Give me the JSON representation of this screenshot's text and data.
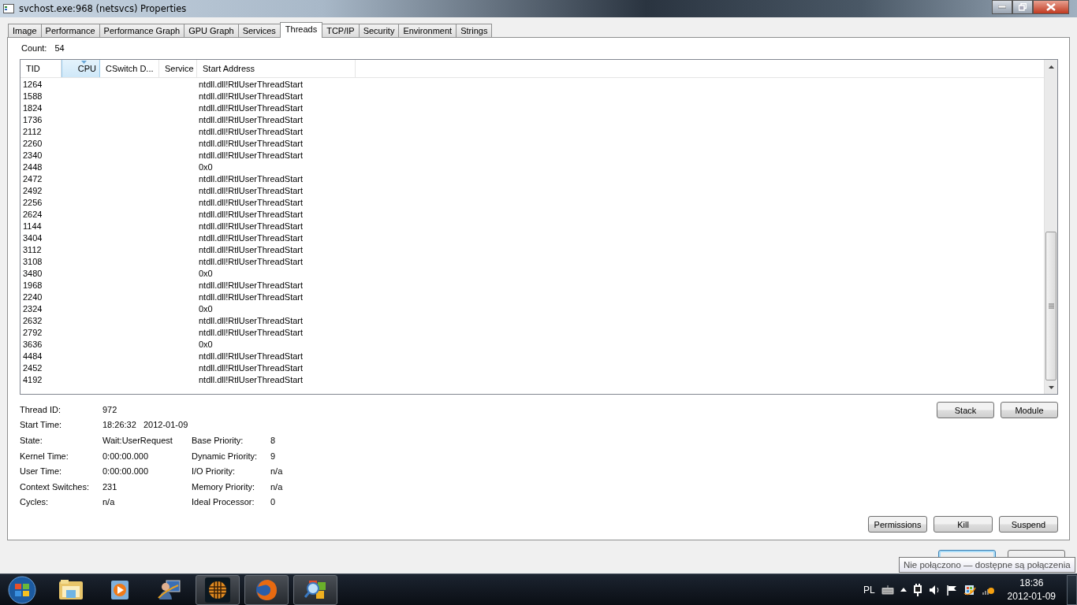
{
  "window": {
    "title": "svchost.exe:968 (netsvcs) Properties"
  },
  "tabs": [
    {
      "label": "Image",
      "selected": false
    },
    {
      "label": "Performance",
      "selected": false
    },
    {
      "label": "Performance Graph",
      "selected": false
    },
    {
      "label": "GPU Graph",
      "selected": false
    },
    {
      "label": "Services",
      "selected": false
    },
    {
      "label": "Threads",
      "selected": true
    },
    {
      "label": "TCP/IP",
      "selected": false
    },
    {
      "label": "Security",
      "selected": false
    },
    {
      "label": "Environment",
      "selected": false
    },
    {
      "label": "Strings",
      "selected": false
    }
  ],
  "count": {
    "label": "Count:",
    "value": "54"
  },
  "threads": {
    "columns": [
      {
        "label": "TID",
        "sorted": false
      },
      {
        "label": "CPU",
        "sorted": true
      },
      {
        "label": "CSwitch D...",
        "sorted": false
      },
      {
        "label": "Service",
        "sorted": false
      },
      {
        "label": "Start Address",
        "sorted": false
      }
    ],
    "rows": [
      {
        "tid": "1264",
        "start_address": "ntdll.dll!RtlUserThreadStart"
      },
      {
        "tid": "1588",
        "start_address": "ntdll.dll!RtlUserThreadStart"
      },
      {
        "tid": "1824",
        "start_address": "ntdll.dll!RtlUserThreadStart"
      },
      {
        "tid": "1736",
        "start_address": "ntdll.dll!RtlUserThreadStart"
      },
      {
        "tid": "2112",
        "start_address": "ntdll.dll!RtlUserThreadStart"
      },
      {
        "tid": "2260",
        "start_address": "ntdll.dll!RtlUserThreadStart"
      },
      {
        "tid": "2340",
        "start_address": "ntdll.dll!RtlUserThreadStart"
      },
      {
        "tid": "2448",
        "start_address": "0x0"
      },
      {
        "tid": "2472",
        "start_address": "ntdll.dll!RtlUserThreadStart"
      },
      {
        "tid": "2492",
        "start_address": "ntdll.dll!RtlUserThreadStart"
      },
      {
        "tid": "2256",
        "start_address": "ntdll.dll!RtlUserThreadStart"
      },
      {
        "tid": "2624",
        "start_address": "ntdll.dll!RtlUserThreadStart"
      },
      {
        "tid": "1144",
        "start_address": "ntdll.dll!RtlUserThreadStart"
      },
      {
        "tid": "3404",
        "start_address": "ntdll.dll!RtlUserThreadStart"
      },
      {
        "tid": "3112",
        "start_address": "ntdll.dll!RtlUserThreadStart"
      },
      {
        "tid": "3108",
        "start_address": "ntdll.dll!RtlUserThreadStart"
      },
      {
        "tid": "3480",
        "start_address": "0x0"
      },
      {
        "tid": "1968",
        "start_address": "ntdll.dll!RtlUserThreadStart"
      },
      {
        "tid": "2240",
        "start_address": "ntdll.dll!RtlUserThreadStart"
      },
      {
        "tid": "2324",
        "start_address": "0x0"
      },
      {
        "tid": "2632",
        "start_address": "ntdll.dll!RtlUserThreadStart"
      },
      {
        "tid": "2792",
        "start_address": "ntdll.dll!RtlUserThreadStart"
      },
      {
        "tid": "3636",
        "start_address": "0x0"
      },
      {
        "tid": "4484",
        "start_address": "ntdll.dll!RtlUserThreadStart"
      },
      {
        "tid": "2452",
        "start_address": "ntdll.dll!RtlUserThreadStart"
      },
      {
        "tid": "4192",
        "start_address": "ntdll.dll!RtlUserThreadStart"
      }
    ]
  },
  "details": [
    {
      "left": {
        "label": "Thread ID:",
        "value": "972"
      }
    },
    {
      "left": {
        "label": "Start Time:",
        "value": "18:26:32   2012-01-09"
      }
    },
    {
      "left": {
        "label": "State:",
        "value": "Wait:UserRequest"
      },
      "right": {
        "label": "Base Priority:",
        "value": "8"
      }
    },
    {
      "left": {
        "label": "Kernel Time:",
        "value": "0:00:00.000"
      },
      "right": {
        "label": "Dynamic Priority:",
        "value": "9"
      }
    },
    {
      "left": {
        "label": "User Time:",
        "value": "0:00:00.000"
      },
      "right": {
        "label": "I/O Priority:",
        "value": "n/a"
      }
    },
    {
      "left": {
        "label": "Context Switches:",
        "value": "231"
      },
      "right": {
        "label": "Memory Priority:",
        "value": "n/a"
      }
    },
    {
      "left": {
        "label": "Cycles:",
        "value": "n/a"
      },
      "right": {
        "label": "Ideal Processor:",
        "value": "0"
      }
    }
  ],
  "detail_buttons": [
    "Stack",
    "Module"
  ],
  "action_buttons": [
    "Permissions",
    "Kill",
    "Suspend"
  ],
  "dialog_buttons": [
    {
      "focused": true
    },
    {
      "focused": false
    }
  ],
  "tooltip": "Nie połączono — dostępne są połączenia",
  "taskbar": {
    "apps": [
      {
        "kind": "folder",
        "active": false
      },
      {
        "kind": "media",
        "active": false
      },
      {
        "kind": "user-monitor",
        "active": false
      },
      {
        "kind": "globe",
        "active": true
      },
      {
        "kind": "firefox",
        "active": true
      },
      {
        "kind": "magnifier",
        "active": true
      }
    ],
    "language": "PL",
    "time": "18:36",
    "date": "2012-01-09"
  }
}
